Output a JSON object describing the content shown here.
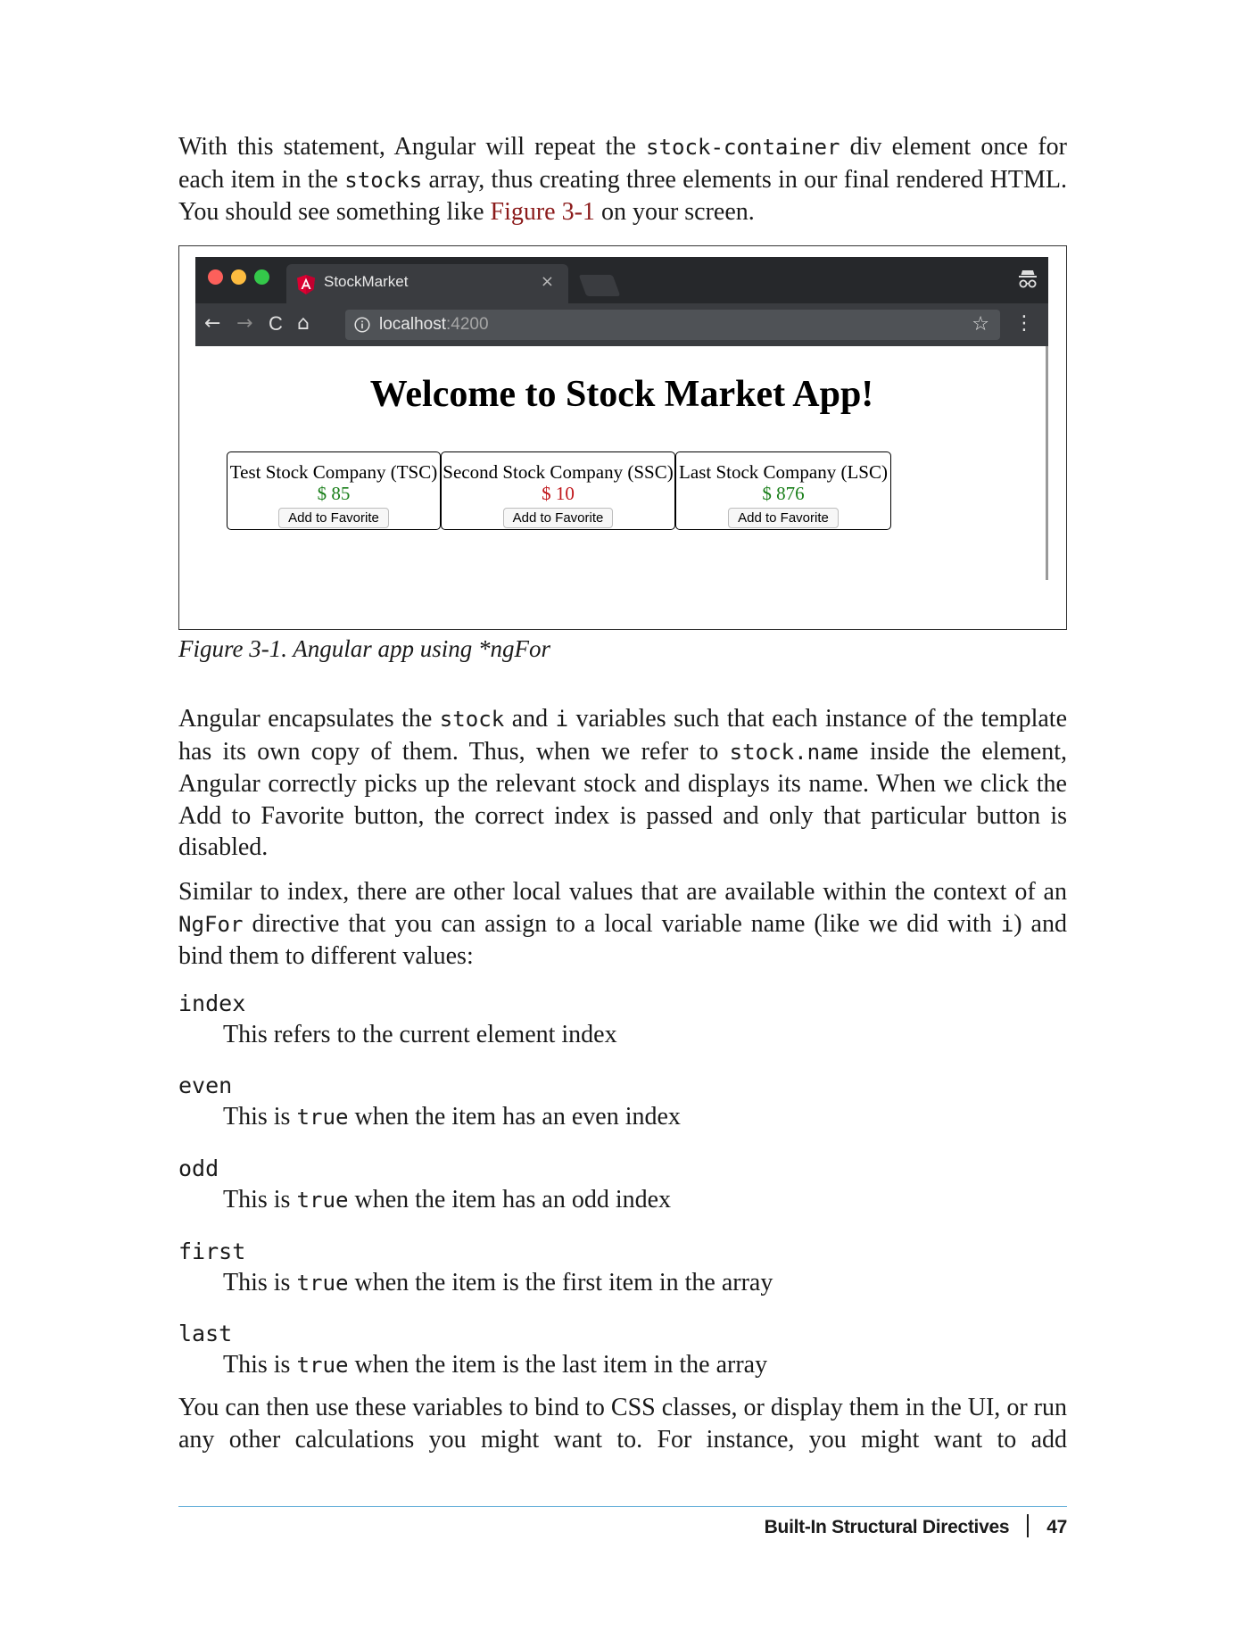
{
  "intro": {
    "t1": "With this statement, Angular will repeat the ",
    "c1": "stock-container",
    "t2": " div element once for each item in the ",
    "c2": "stocks",
    "t3": " array, thus creating three elements in our final rendered HTML. You should see something like ",
    "xref": "Figure 3-1",
    "t4": " on your screen."
  },
  "figure": {
    "browser": {
      "tab_title": "StockMarket",
      "tab_close": "×",
      "url_host": "localhost",
      "url_port": ":4200",
      "back_icon": "←",
      "forward_icon": "→",
      "reload_icon": "C",
      "home_icon": "⌂",
      "star_icon": "☆",
      "menu_icon": "⋮",
      "colors": {
        "close": "#fc605b",
        "minimize": "#fdbc40",
        "maximize": "#34c84a",
        "titlebar": "#26282b",
        "toolbar": "#3a3c40",
        "angular": "#dd0031"
      }
    },
    "app": {
      "title": "Welcome to Stock Market App!",
      "stocks": [
        {
          "name": "Test Stock Company (TSC)",
          "price": "$ 85",
          "price_color": "#1a7f1a",
          "button": "Add to Favorite"
        },
        {
          "name": "Second Stock Company (SSC)",
          "price": "$ 10",
          "price_color": "#c0161b",
          "button": "Add to Favorite"
        },
        {
          "name": "Last Stock Company (LSC)",
          "price": "$ 876",
          "price_color": "#1a7f1a",
          "button": "Add to Favorite"
        }
      ]
    },
    "caption": "Figure 3-1. Angular app using *ngFor"
  },
  "para2": {
    "t1": "Angular encapsulates the ",
    "c1": "stock",
    "t2": " and ",
    "c2": "i",
    "t3": " variables such that each instance of the template has its own copy of them. Thus, when we refer to ",
    "c3": "stock.name",
    "t4": " inside the element, Angular correctly picks up the relevant stock and displays its name. When we click the Add to Favorite button, the correct index is passed and only that particular button is disabled."
  },
  "para3": {
    "t1": "Similar to index, there are other local values that are available within the context of an ",
    "c1": "NgFor",
    "t2": " directive that you can assign to a local variable name (like we did with ",
    "c2": "i",
    "t3": ") and bind them to different values:"
  },
  "definitions": [
    {
      "term": "index",
      "pre": "This refers to the current element index",
      "code": "",
      "post": ""
    },
    {
      "term": "even",
      "pre": "This is ",
      "code": "true",
      "post": " when the item has an even index"
    },
    {
      "term": "odd",
      "pre": "This is ",
      "code": "true",
      "post": " when the item has an odd index"
    },
    {
      "term": "first",
      "pre": "This is ",
      "code": "true",
      "post": " when the item is the first item in the array"
    },
    {
      "term": "last",
      "pre": "This is ",
      "code": "true",
      "post": " when the item is the last item in the array"
    }
  ],
  "para4": "You can then use these variables to bind to CSS classes, or display them in the UI, or run any other calculations you might want to. For instance, you might want to add",
  "footer": {
    "section": "Built-In Structural Directives",
    "page_number": "47"
  }
}
